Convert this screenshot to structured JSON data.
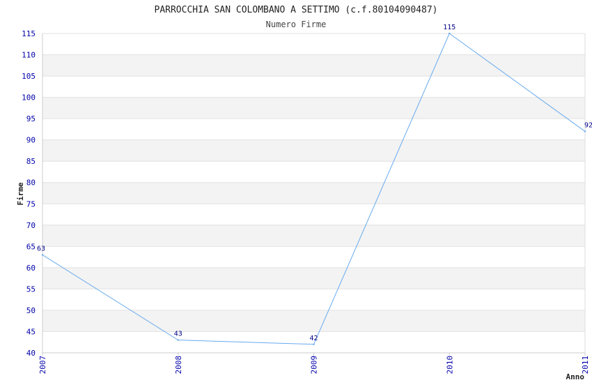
{
  "chart_data": {
    "type": "line",
    "title": "PARROCCHIA SAN COLOMBANO A SETTIMO (c.f.80104090487)",
    "subtitle": "Numero Firme",
    "xlabel": "Anno",
    "ylabel": "Firme",
    "x": [
      "2007",
      "2008",
      "2009",
      "2010",
      "2011"
    ],
    "series": [
      {
        "values": [
          63,
          43,
          42,
          115,
          92
        ],
        "data_labels": [
          "63",
          "43",
          "42",
          "115",
          "92"
        ]
      }
    ],
    "ylim": [
      40,
      115
    ],
    "yticks": [
      "40",
      "45",
      "50",
      "55",
      "60",
      "65",
      "70",
      "75",
      "80",
      "85",
      "90",
      "95",
      "100",
      "105",
      "110",
      "115"
    ],
    "grid": true,
    "band_colors": [
      "#ffffff",
      "#f3f3f3"
    ],
    "line_color": "#66aaee",
    "tick_color": "#0000aa"
  }
}
